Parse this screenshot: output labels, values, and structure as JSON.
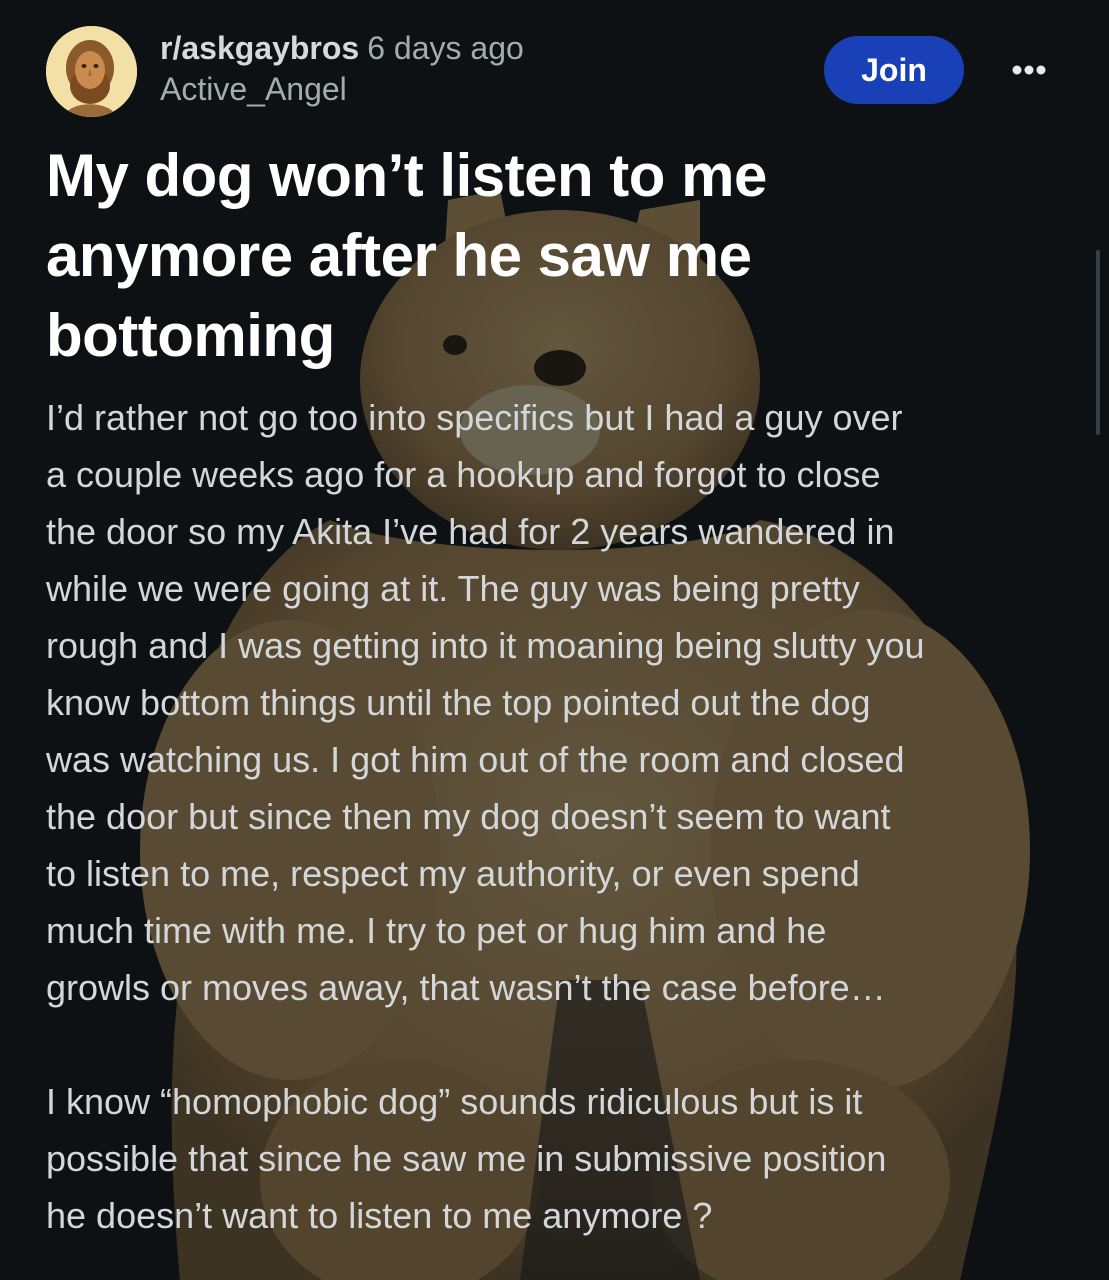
{
  "header": {
    "subreddit": "r/askgaybros",
    "timestamp": "6 days ago",
    "username": "Active_Angel",
    "avatar_icon": "bust-statue-avatar-icon"
  },
  "actions": {
    "join_label": "Join",
    "more_icon": "more-options-icon"
  },
  "post": {
    "title": "My dog won’t listen to me anymore after he saw me bottoming",
    "paragraphs": [
      "I’d rather not go too into specifics but I had a guy over\na couple weeks ago for a hookup and forgot to close\nthe door so my Akita I’ve had for 2 years wandered in\nwhile we were going at it. The guy was being pretty\nrough and I was getting into it moaning being slutty you\nknow bottom things until the top pointed out the dog\nwas watching us. I got him out of the room and closed\nthe door but since then my dog doesn’t seem to want\nto listen to me, respect my authority, or even spend\nmuch time with me. I try to pet or hug him and he\ngrowls or moves away, that wasn’t the case before…",
      "I know “homophobic dog” sounds ridiculous but is it\npossible that since he saw me in submissive position\nhe doesn’t want to listen to me anymore ?"
    ]
  },
  "colors": {
    "background": "#0e1113",
    "join_button": "#1a40b8",
    "title_text": "#ffffff",
    "body_text": "#d3d7da",
    "muted_text": "#a6abae"
  }
}
